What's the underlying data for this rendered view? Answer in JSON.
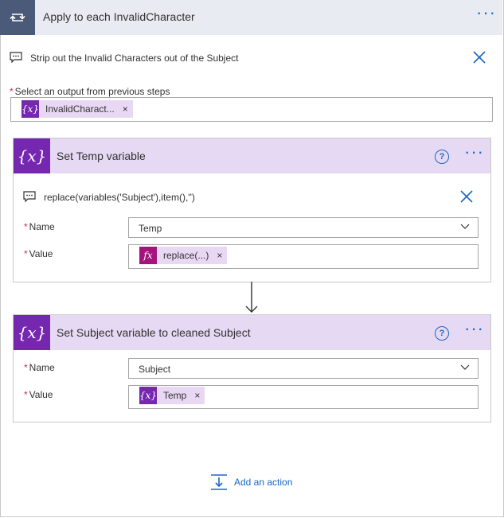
{
  "header": {
    "title": "Apply to each InvalidCharacter",
    "more_label": "···"
  },
  "loop_comment": "Strip out the Invalid Characters out of the Subject",
  "select_output": {
    "label": "Select an output from previous steps",
    "required": "*",
    "token": {
      "icon": "{x}",
      "label": "InvalidCharact...",
      "remove": "×"
    }
  },
  "card_temp": {
    "title": "Set Temp variable",
    "help": "?",
    "more_label": "···",
    "comment": "replace(variables('Subject'),item(),'')",
    "name_label": "Name",
    "name_value": "Temp",
    "value_label": "Value",
    "value_token": {
      "icon": "fx",
      "label": "replace(...)",
      "remove": "×"
    },
    "required": "*"
  },
  "card_subject": {
    "title": "Set Subject variable to cleaned Subject",
    "help": "?",
    "more_label": "···",
    "name_label": "Name",
    "name_value": "Subject",
    "value_label": "Value",
    "value_token": {
      "icon": "{x}",
      "label": "Temp",
      "remove": "×"
    },
    "required": "*"
  },
  "add_action": "Add an action",
  "colors": {
    "loop_header_icon_bg": "#4a5a78",
    "loop_header_bg": "#e8ebf2",
    "variable_purple": "#7527b0",
    "variable_header_bg": "#e6d9f3",
    "token_bg": "#e9d8f3",
    "expression_magenta": "#a4147c",
    "link_blue": "#1a67c5",
    "required_red": "#c4314b"
  }
}
